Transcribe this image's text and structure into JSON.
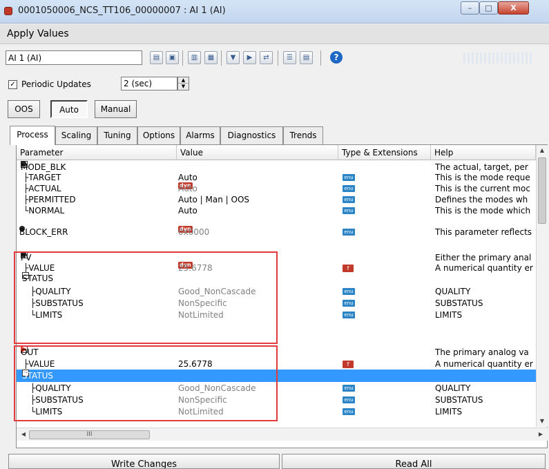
{
  "window": {
    "title": "0001050006_NCS_TT106_00000007 : AI 1 (AI)",
    "min_label": "–",
    "max_label": "□",
    "close_label": "X"
  },
  "section_title": "Apply Values",
  "toolbar": {
    "block_selector_value": "AI 1 (AI)",
    "help_label": "?"
  },
  "periodic": {
    "checkbox_mark": "✓",
    "label": "Periodic Updates",
    "interval_value": "2 (sec)"
  },
  "modes": [
    "OOS",
    "Auto",
    "Manual"
  ],
  "tabs": [
    "Process",
    "Scaling",
    "Tuning",
    "Options",
    "Alarms",
    "Diagnostics",
    "Trends"
  ],
  "grid": {
    "columns": [
      "Parameter",
      "Value",
      "Type & Extensions",
      "Help"
    ],
    "badges": {
      "dyn": "dyn",
      "enu": "enu",
      "f": "f"
    },
    "rows": {
      "mode_blk": {
        "param": "MODE_BLK",
        "help": "The actual, target, per"
      },
      "mode_target": {
        "param": "TARGET",
        "value": "Auto",
        "help": "This is the mode reque"
      },
      "mode_actual": {
        "param": "ACTUAL",
        "value": "Auto",
        "help": "This is the current moc"
      },
      "mode_permitted": {
        "param": "PERMITTED",
        "value": "Auto | Man | OOS",
        "help": "Defines the modes wh"
      },
      "mode_normal": {
        "param": "NORMAL",
        "value": "Auto",
        "help": "This is the mode which"
      },
      "block_err": {
        "param": "BLOCK_ERR",
        "value": "0x0000",
        "help": "This parameter reflects"
      },
      "pv": {
        "param": "PV",
        "help": "Either the primary anal"
      },
      "pv_value": {
        "param": "VALUE",
        "value": "25.6778",
        "help": "A numerical quantity er"
      },
      "pv_status": {
        "param": "STATUS"
      },
      "pv_quality": {
        "param": "QUALITY",
        "value": "Good_NonCascade",
        "help": "QUALITY"
      },
      "pv_substatus": {
        "param": "SUBSTATUS",
        "value": "NonSpecific",
        "help": "SUBSTATUS"
      },
      "pv_limits": {
        "param": "LIMITS",
        "value": "NotLimited",
        "help": "LIMITS"
      },
      "out": {
        "param": "OUT",
        "help": "The primary analog va"
      },
      "out_value": {
        "param": "VALUE",
        "value": "25.6778",
        "help": "A numerical quantity er"
      },
      "out_status": {
        "param": "STATUS"
      },
      "out_quality": {
        "param": "QUALITY",
        "value": "Good_NonCascade",
        "help": "QUALITY"
      },
      "out_substatus": {
        "param": "SUBSTATUS",
        "value": "NonSpecific",
        "help": "SUBSTATUS"
      },
      "out_limits": {
        "param": "LIMITS",
        "value": "NotLimited",
        "help": "LIMITS"
      }
    },
    "hscroll_grip": "III"
  },
  "buttons": {
    "write_changes": "Write Changes",
    "read_all": "Read All"
  },
  "colors": {
    "selection": "#3399ff",
    "highlight_box": "#e23a3a"
  }
}
